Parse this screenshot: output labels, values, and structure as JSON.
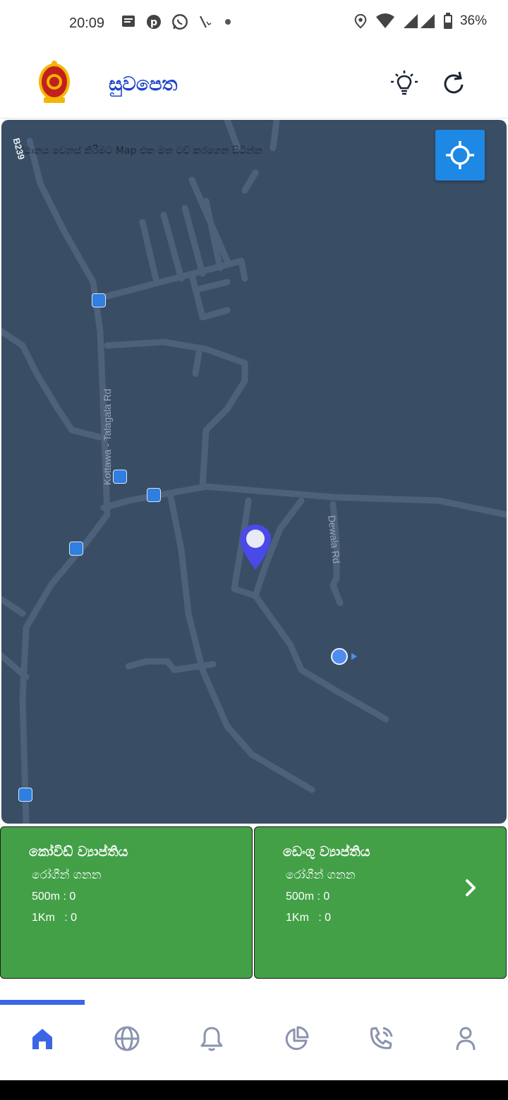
{
  "status_bar": {
    "time": "20:09",
    "battery": "36%",
    "icons": [
      "message-icon",
      "pinterest-icon",
      "whatsapp-icon",
      "call-missed-icon",
      "dot-icon",
      "location-icon",
      "wifi-icon",
      "signal-icon",
      "battery-icon"
    ]
  },
  "header": {
    "title": "සුවපෙත",
    "logo": "sri-lanka-emblem",
    "actions": [
      "lightbulb-icon",
      "refresh-icon"
    ]
  },
  "map": {
    "hint": "ස්ථානය වෙනස් කිරීමට Map එක මත ටච් කරගෙන සිටින්න",
    "road_labels": {
      "b239": "B239",
      "kottawa": "Kottawa - Talagala Rd",
      "dewala": "Dewala Rd"
    },
    "background_color": "#394d65",
    "pin_color": "#4a4ae8"
  },
  "cards": [
    {
      "title": "කෝවිඩ් ව්‍යාප්තිය",
      "subtitle": "රෝගීන් ගනන",
      "line_500m": "500m : 0",
      "line_1km": "1Km   : 0",
      "color": "#43a047"
    },
    {
      "title": "ඩෙංගු ව්‍යාප්තිය",
      "subtitle": "රෝගීන් ගනන",
      "line_500m": "500m : 0",
      "line_1km": "1Km   : 0",
      "color": "#43a047"
    }
  ],
  "bottom_nav": {
    "items": [
      "home-icon",
      "globe-icon",
      "bell-icon",
      "pie-chart-icon",
      "phone-call-icon",
      "user-icon"
    ],
    "active": "home-icon",
    "active_color": "#3c65e6",
    "inactive_color": "#8a93ad"
  }
}
